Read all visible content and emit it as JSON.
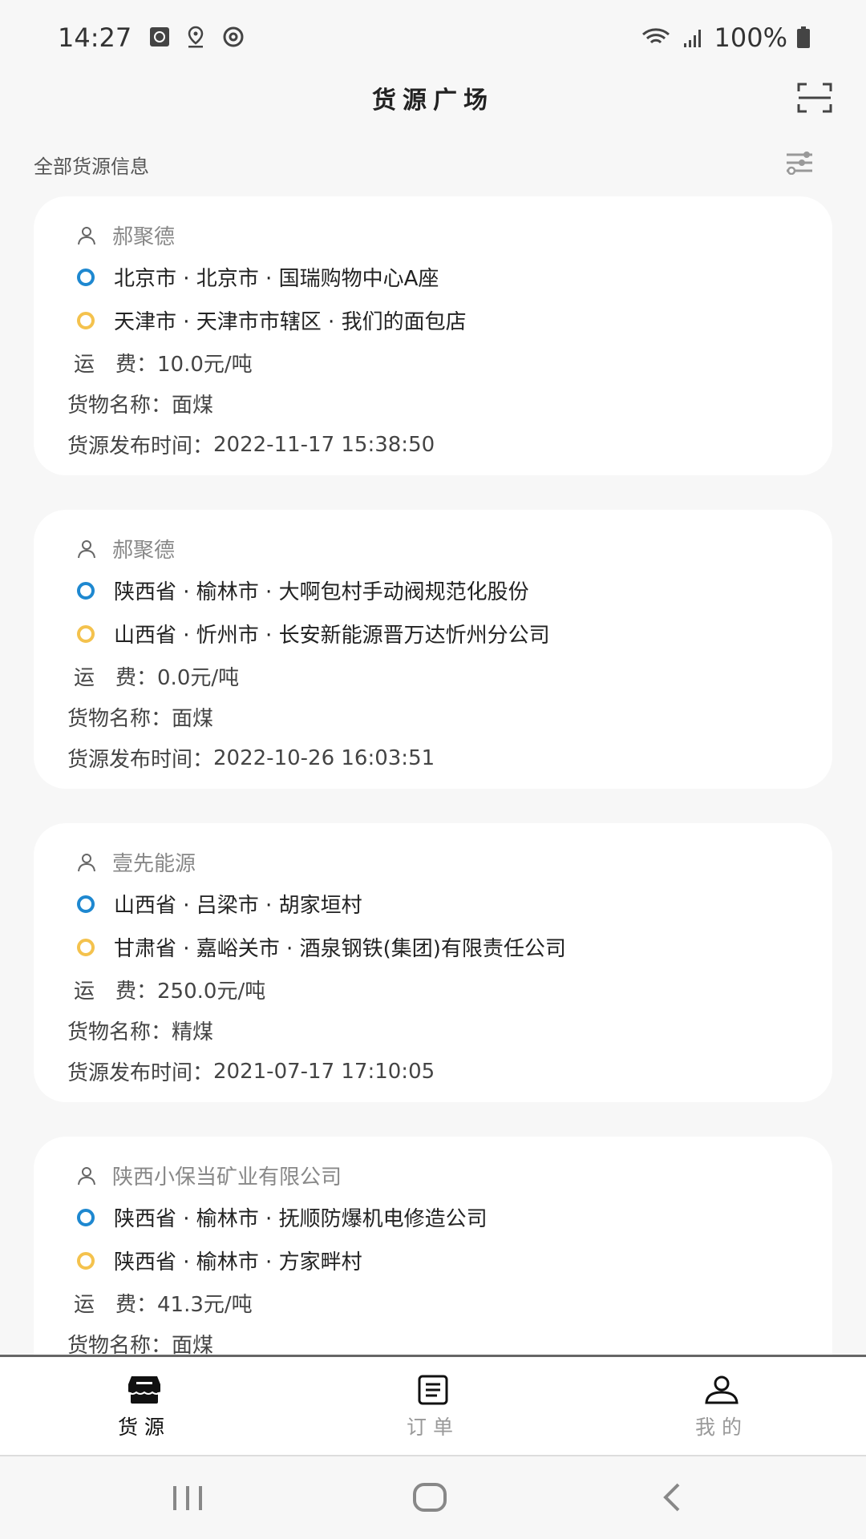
{
  "status_bar": {
    "time": "14:27",
    "battery": "100%"
  },
  "header": {
    "title": "货源广场"
  },
  "subheader": {
    "label": "全部货源信息"
  },
  "colors": {
    "origin": "#1e88d0",
    "destination": "#f4c24d"
  },
  "cards": [
    {
      "publisher": "郝聚德",
      "from": "北京市 · 北京市 · 国瑞购物中心A座",
      "to": "天津市 · 天津市市辖区 · 我们的面包店",
      "fee_label": "运　费：",
      "fee": "10.0元/吨",
      "goods_label": "货物名称：",
      "goods": "面煤",
      "time_label": "货源发布时间：",
      "time": "2022-11-17 15:38:50"
    },
    {
      "publisher": "郝聚德",
      "from": "陕西省 · 榆林市 · 大啊包村手动阀规范化股份",
      "to": "山西省 · 忻州市 · 长安新能源晋万达忻州分公司",
      "fee_label": "运　费：",
      "fee": "0.0元/吨",
      "goods_label": "货物名称：",
      "goods": "面煤",
      "time_label": "货源发布时间：",
      "time": "2022-10-26 16:03:51"
    },
    {
      "publisher": "壹先能源",
      "from": "山西省 · 吕梁市 · 胡家垣村",
      "to": "甘肃省 · 嘉峪关市 · 酒泉钢铁(集团)有限责任公司",
      "fee_label": "运　费：",
      "fee": "250.0元/吨",
      "goods_label": "货物名称：",
      "goods": "精煤",
      "time_label": "货源发布时间：",
      "time": "2021-07-17 17:10:05"
    },
    {
      "publisher": "陕西小保当矿业有限公司",
      "from": "陕西省 · 榆林市 · 抚顺防爆机电修造公司",
      "to": "陕西省 · 榆林市 · 方家畔村",
      "fee_label": "运　费：",
      "fee": "41.3元/吨",
      "goods_label": "货物名称：",
      "goods": "面煤",
      "time_label": "",
      "time": ""
    }
  ],
  "tabs": [
    {
      "label": "货源",
      "active": true
    },
    {
      "label": "订单"
    },
    {
      "label": "我的"
    }
  ]
}
